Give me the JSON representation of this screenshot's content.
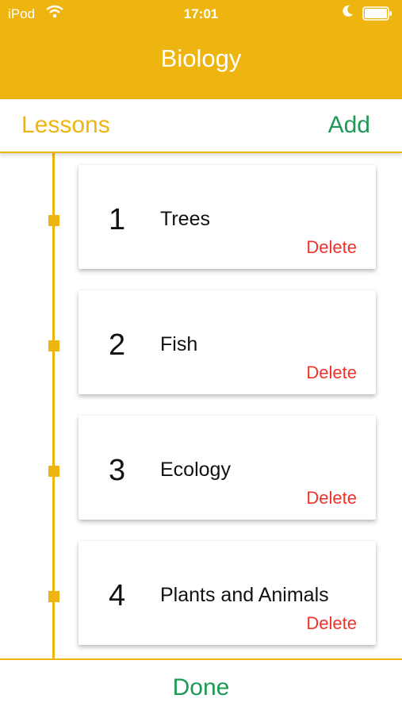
{
  "status_bar": {
    "carrier": "iPod",
    "time": "17:01"
  },
  "nav": {
    "title": "Biology"
  },
  "subheader": {
    "section_label": "Lessons",
    "add_label": "Add"
  },
  "lessons": [
    {
      "number": "1",
      "name": "Trees",
      "delete_label": "Delete"
    },
    {
      "number": "2",
      "name": "Fish",
      "delete_label": "Delete"
    },
    {
      "number": "3",
      "name": "Ecology",
      "delete_label": "Delete"
    },
    {
      "number": "4",
      "name": "Plants and Animals",
      "delete_label": "Delete"
    }
  ],
  "footer": {
    "done_label": "Done"
  },
  "colors": {
    "accent": "#EEB511",
    "action": "#1E9A54",
    "destructive": "#F0322C"
  }
}
